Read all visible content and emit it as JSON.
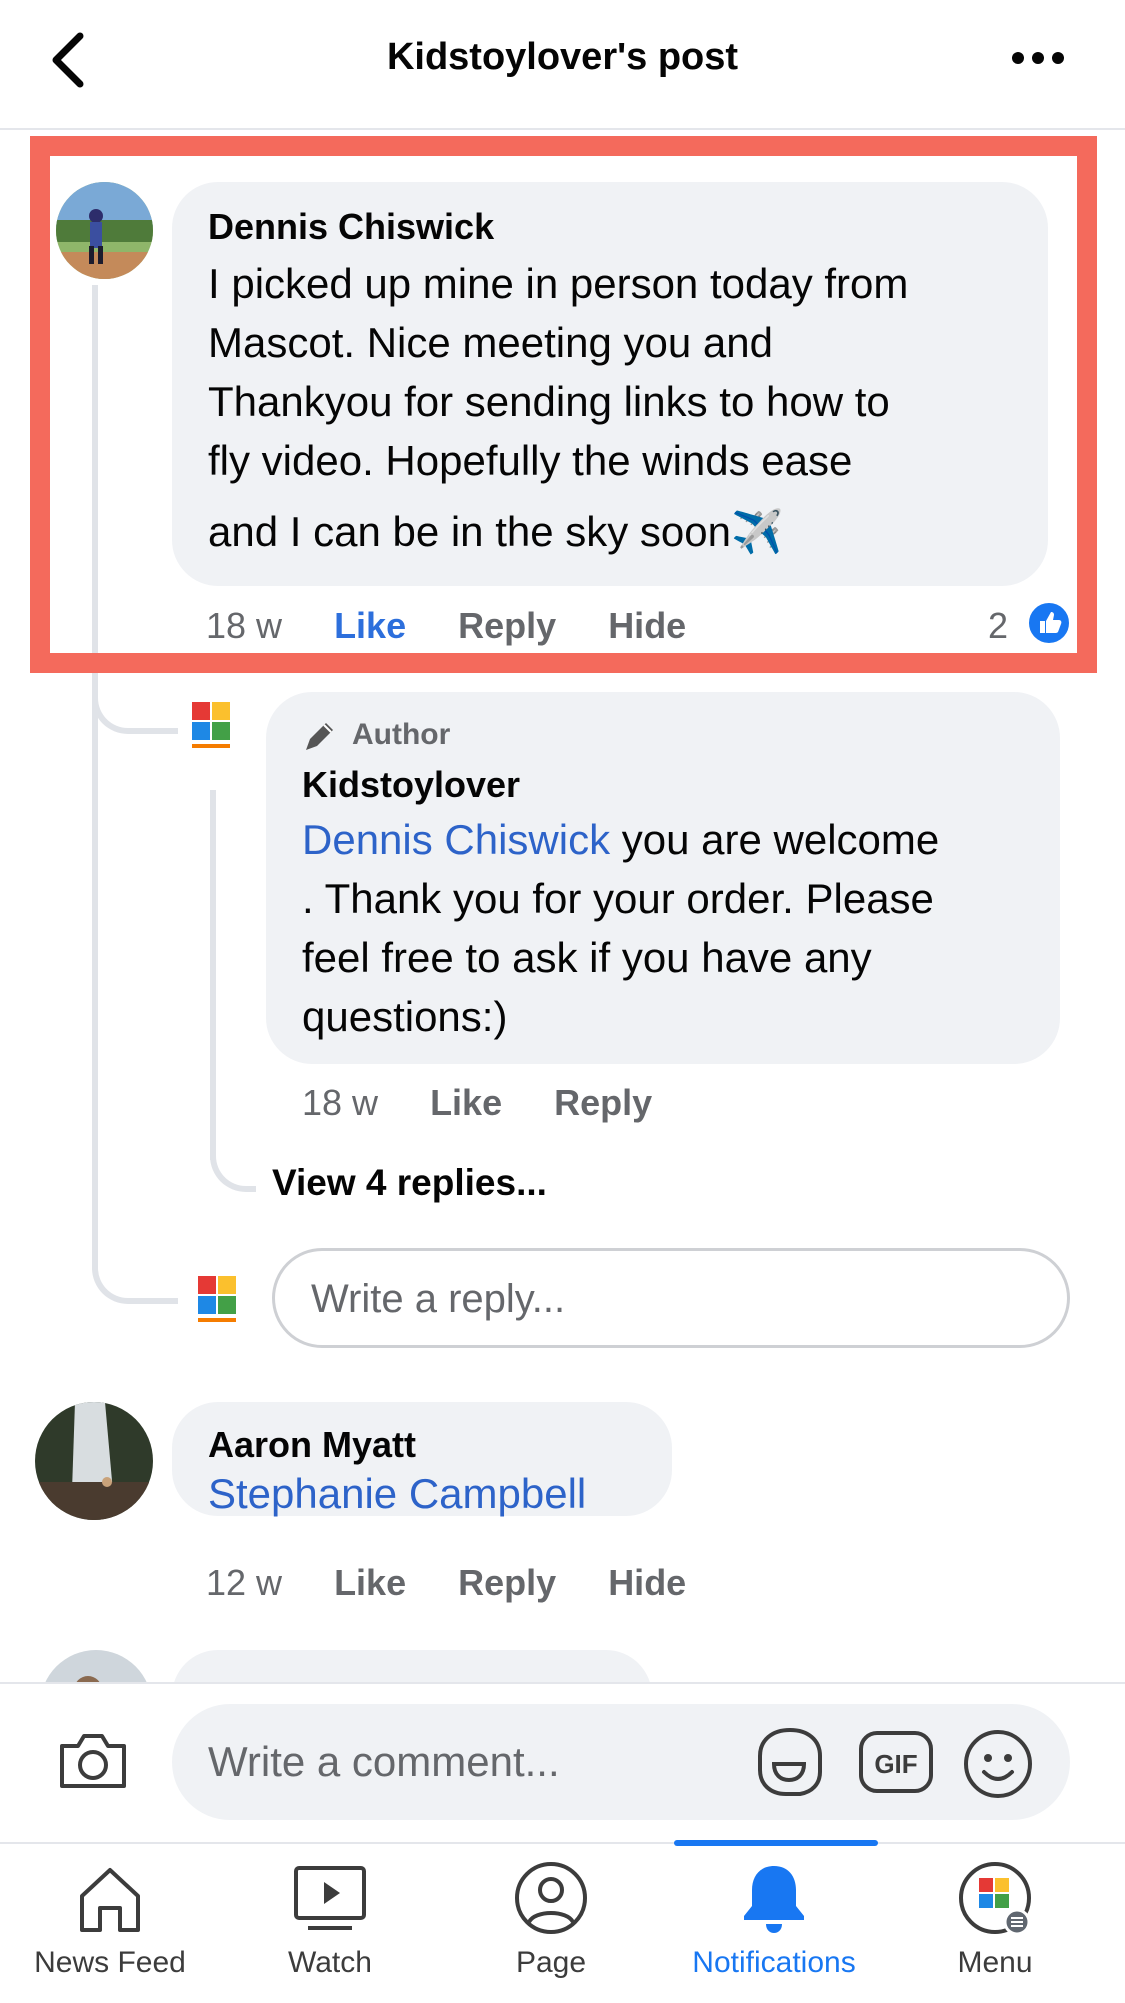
{
  "header": {
    "title": "Kidstoylover's post"
  },
  "comment_1": {
    "author": "Dennis Chiswick",
    "text_lines": [
      "I picked up mine in person today from",
      "Mascot. Nice meeting you and",
      "Thankyou for sending links to how to",
      "fly video. Hopefully the winds ease",
      "and I can be in the sky soon✈️"
    ],
    "time": "18 w",
    "like": "Like",
    "reply": "Reply",
    "hide": "Hide",
    "reaction_count": "2"
  },
  "reply_1": {
    "badge": "Author",
    "author": "Kidstoylover",
    "mention": "Dennis Chiswick",
    "line1_rest": " you are welcome",
    "text_lines": [
      ". Thank you for your order. Please",
      "feel free to ask if you have any",
      "questions:)"
    ],
    "time": "18 w",
    "like": "Like",
    "reply": "Reply"
  },
  "view_replies": "View 4 replies...",
  "reply_input": {
    "placeholder": "Write a reply..."
  },
  "comment_2": {
    "author": "Aaron Myatt",
    "mention": "Stephanie Campbell",
    "time": "12 w",
    "like": "Like",
    "reply": "Reply",
    "hide": "Hide"
  },
  "composer": {
    "placeholder": "Write a comment..."
  },
  "tabs": [
    {
      "label": "News Feed",
      "icon": "home-icon"
    },
    {
      "label": "Watch",
      "icon": "video-icon"
    },
    {
      "label": "Page",
      "icon": "profile-icon"
    },
    {
      "label": "Notifications",
      "icon": "bell-icon",
      "active": true
    },
    {
      "label": "Menu",
      "icon": "menu-avatar-icon"
    }
  ],
  "colors": {
    "accent": "#1877f2",
    "highlight": "#f46a5c",
    "bubble": "#f0f2f5",
    "link": "#2d63c9"
  }
}
